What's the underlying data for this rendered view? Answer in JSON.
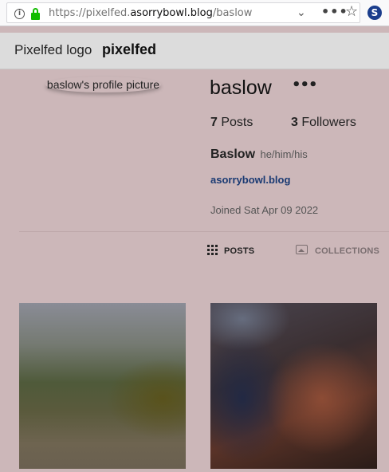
{
  "browser": {
    "url_prefix": "https://pixelfed.",
    "url_host": "asorrybowl.blog",
    "url_path": "/baslow",
    "icons": {
      "info": "info-icon",
      "lock": "lock-icon",
      "dropdown": "chevron-down-icon",
      "page_actions": "more-horizontal-icon",
      "bookmark": "star-icon",
      "extension": "extension-s-icon"
    },
    "info_glyph": "i",
    "chevron_glyph": "⌄",
    "more_glyph": "•••",
    "star_glyph": "☆",
    "extension_letter": "S"
  },
  "header": {
    "logo_alt": "Pixelfed logo",
    "brand": "pixelfed"
  },
  "profile": {
    "avatar_alt": "baslow's profile picture",
    "username": "baslow",
    "more_glyph": "•••",
    "posts_count": "7",
    "posts_label": "Posts",
    "followers_count": "3",
    "followers_label": "Followers",
    "display_name": "Baslow",
    "pronouns": "he/him/his",
    "website": "asorrybowl.blog",
    "joined": "Joined Sat Apr 09 2022"
  },
  "tabs": {
    "posts": "POSTS",
    "collections": "COLLECTIONS",
    "active": "posts"
  },
  "colors": {
    "page_background": "#ccb7b9",
    "header_background": "#dcdcdc",
    "link": "#1a3a73"
  },
  "posts": [
    {
      "kind": "blurred image"
    },
    {
      "kind": "blurred image"
    }
  ]
}
